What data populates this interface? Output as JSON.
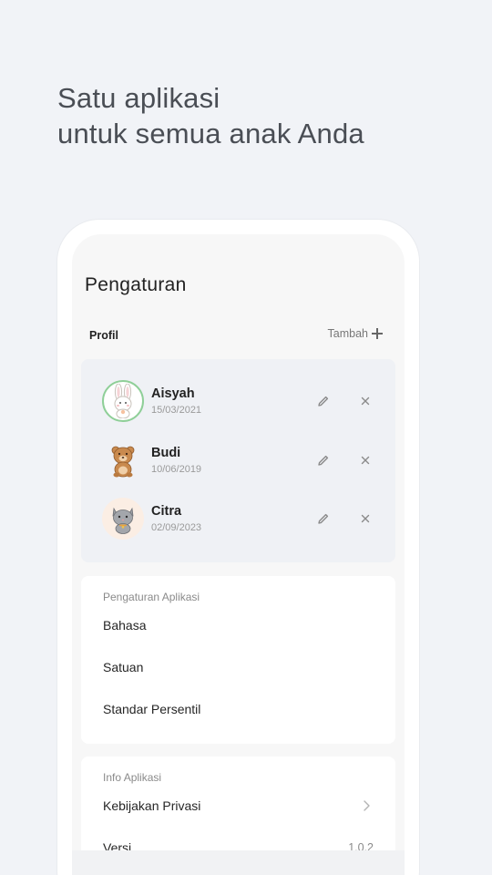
{
  "headline": {
    "line1": "Satu aplikasi",
    "line2": "untuk semua anak Anda"
  },
  "screen": {
    "title": "Pengaturan",
    "profiles_section": {
      "label": "Profil",
      "add_label": "Tambah"
    },
    "profiles": [
      {
        "name": "Aisyah",
        "dob": "15/03/2021",
        "avatar": "bunny-icon",
        "selected": true
      },
      {
        "name": "Budi",
        "dob": "10/06/2019",
        "avatar": "bear-icon",
        "selected": false
      },
      {
        "name": "Citra",
        "dob": "02/09/2023",
        "avatar": "cat-icon",
        "selected": false
      }
    ],
    "app_settings": {
      "header": "Pengaturan Aplikasi",
      "items": [
        "Bahasa",
        "Satuan",
        "Standar Persentil"
      ]
    },
    "app_info": {
      "header": "Info Aplikasi",
      "privacy": "Kebijakan Privasi",
      "version_label": "Versi",
      "version_value": "1.0.2"
    }
  },
  "colors": {
    "background": "#f1f3f7",
    "selected_ring": "#8fcf98",
    "profile_card": "#eff1f5"
  }
}
